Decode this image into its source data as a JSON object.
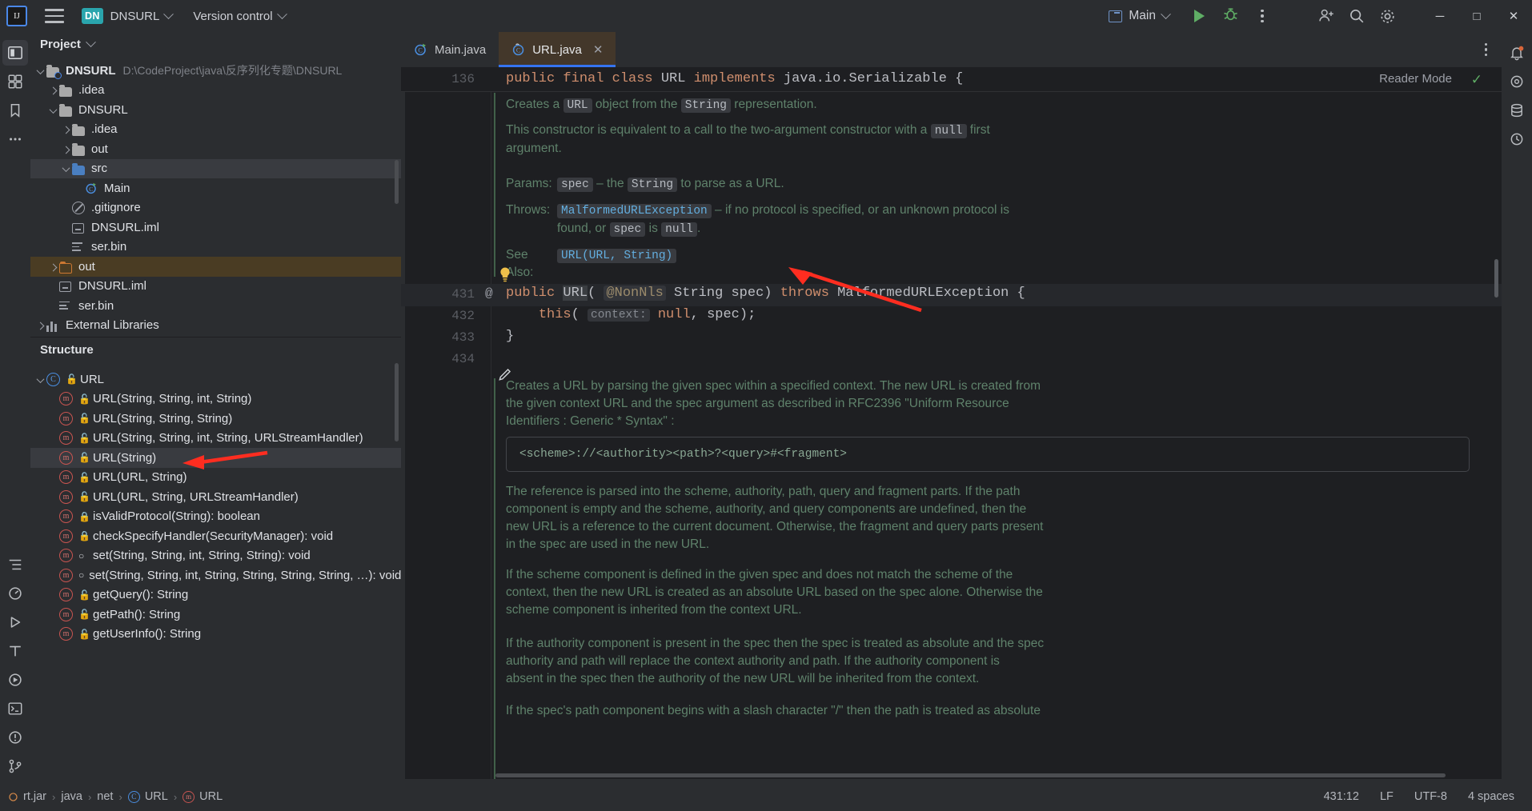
{
  "titlebar": {
    "logo": "IJ",
    "menu_icon": "hamburger-menu-icon",
    "project_badge": "DN",
    "project_name": "DNSURL",
    "version_control": "Version control",
    "run_config": "Main",
    "run_icon": "run-play-icon",
    "debug_icon": "debug-bug-icon",
    "more_icon": "more-vertical-icon",
    "add_user_icon": "add-user-icon",
    "search_icon": "search-icon",
    "settings_icon": "gear-icon",
    "minimize": "─",
    "maximize": "□",
    "close": "✕"
  },
  "left_rail": [
    {
      "name": "project-tool-icon",
      "glyph": "▣"
    },
    {
      "name": "commit-tool-icon",
      "glyph": "⊞"
    },
    {
      "name": "bookmarks-tool-icon",
      "glyph": "⚑"
    },
    {
      "name": "more-tool-icon",
      "glyph": "⋯"
    },
    {
      "name": "structure-tool-icon",
      "glyph": "≡"
    },
    {
      "name": "profiler-tool-icon",
      "glyph": "◔"
    },
    {
      "name": "run-tool-icon",
      "glyph": "▷"
    },
    {
      "name": "terminal-tool-icon",
      "glyph": "⌨"
    },
    {
      "name": "services-tool-icon",
      "glyph": "▶"
    },
    {
      "name": "problems-tool-icon",
      "glyph": "!"
    },
    {
      "name": "git-tool-icon",
      "glyph": "⑂"
    }
  ],
  "right_rail": [
    {
      "name": "notifications-icon",
      "glyph": "🔔"
    },
    {
      "name": "ai-assistant-icon",
      "glyph": "◎"
    },
    {
      "name": "database-icon",
      "glyph": "⛁"
    },
    {
      "name": "history-icon",
      "glyph": "⟲"
    }
  ],
  "project_panel": {
    "title": "Project",
    "chevron": "chevron-down-icon",
    "tree": [
      {
        "indent": 0,
        "toggle": "down",
        "icon": "folder-module",
        "label": "DNSURL",
        "bold": true,
        "path": "D:\\CodeProject\\java\\反序列化专题\\DNSURL"
      },
      {
        "indent": 1,
        "toggle": "right",
        "icon": "folder",
        "label": ".idea"
      },
      {
        "indent": 1,
        "toggle": "down",
        "icon": "folder",
        "label": "DNSURL"
      },
      {
        "indent": 2,
        "toggle": "right",
        "icon": "folder",
        "label": ".idea"
      },
      {
        "indent": 2,
        "toggle": "right",
        "icon": "folder",
        "label": "out"
      },
      {
        "indent": 2,
        "toggle": "down",
        "icon": "folder-source",
        "label": "src",
        "state": "selected"
      },
      {
        "indent": 3,
        "toggle": "none",
        "icon": "java-class-run",
        "label": "Main"
      },
      {
        "indent": 2,
        "toggle": "none",
        "icon": "gitignore",
        "label": ".gitignore"
      },
      {
        "indent": 2,
        "toggle": "none",
        "icon": "iml-file",
        "label": "DNSURL.iml"
      },
      {
        "indent": 2,
        "toggle": "none",
        "icon": "binary-file",
        "label": "ser.bin"
      },
      {
        "indent": 1,
        "toggle": "right",
        "icon": "folder-excluded",
        "label": "out",
        "state": "highlight"
      },
      {
        "indent": 1,
        "toggle": "none",
        "icon": "iml-file",
        "label": "DNSURL.iml"
      },
      {
        "indent": 1,
        "toggle": "none",
        "icon": "binary-file",
        "label": "ser.bin"
      },
      {
        "indent": 0,
        "toggle": "right",
        "icon": "libraries",
        "label": "External Libraries"
      }
    ]
  },
  "structure_panel": {
    "title": "Structure",
    "items": [
      {
        "indent": 0,
        "toggle": "down",
        "icon": "class-icon",
        "access": "public",
        "label": "URL"
      },
      {
        "indent": 1,
        "toggle": "none",
        "icon": "method-icon",
        "access": "public",
        "label": "URL(String, String, int, String)"
      },
      {
        "indent": 1,
        "toggle": "none",
        "icon": "method-icon",
        "access": "public",
        "label": "URL(String, String, String)"
      },
      {
        "indent": 1,
        "toggle": "none",
        "icon": "method-icon",
        "access": "public",
        "label": "URL(String, String, int, String, URLStreamHandler)"
      },
      {
        "indent": 1,
        "toggle": "none",
        "icon": "method-icon",
        "access": "public",
        "label": "URL(String)",
        "state": "selected"
      },
      {
        "indent": 1,
        "toggle": "none",
        "icon": "method-icon",
        "access": "public",
        "label": "URL(URL, String)"
      },
      {
        "indent": 1,
        "toggle": "none",
        "icon": "method-icon",
        "access": "public",
        "label": "URL(URL, String, URLStreamHandler)"
      },
      {
        "indent": 1,
        "toggle": "none",
        "icon": "method-icon",
        "access": "private",
        "label": "isValidProtocol(String): boolean"
      },
      {
        "indent": 1,
        "toggle": "none",
        "icon": "method-icon",
        "access": "private",
        "label": "checkSpecifyHandler(SecurityManager): void"
      },
      {
        "indent": 1,
        "toggle": "none",
        "icon": "method-icon",
        "access": "package",
        "label": "set(String, String, int, String, String): void"
      },
      {
        "indent": 1,
        "toggle": "none",
        "icon": "method-icon",
        "access": "package",
        "label": "set(String, String, int, String, String, String, String, …): void"
      },
      {
        "indent": 1,
        "toggle": "none",
        "icon": "method-icon",
        "access": "public",
        "label": "getQuery(): String"
      },
      {
        "indent": 1,
        "toggle": "none",
        "icon": "method-icon",
        "access": "public",
        "label": "getPath(): String"
      },
      {
        "indent": 1,
        "toggle": "none",
        "icon": "method-icon",
        "access": "public",
        "label": "getUserInfo(): String"
      }
    ]
  },
  "editor": {
    "tabs": [
      {
        "label": "Main.java",
        "icon": "java-class-run-icon",
        "active": false,
        "closable": false
      },
      {
        "label": "URL.java",
        "icon": "java-class-icon",
        "active": true,
        "closable": true,
        "close": "✕"
      }
    ],
    "tab_options_icon": "more-vertical-icon",
    "reader_mode": "Reader Mode",
    "inspection_check": "✓",
    "sticky_line_number": "136",
    "sticky_code_parts": [
      {
        "t": "public final class ",
        "c": "kw"
      },
      {
        "t": "URL",
        "c": "plain"
      },
      {
        "t": " implements ",
        "c": "kw"
      },
      {
        "t": "java.io.Serializable {",
        "c": "plain"
      }
    ],
    "doc_top": {
      "lines": [
        [
          {
            "t": "Creates a ",
            "c": "txt"
          },
          {
            "t": "URL",
            "c": "mono"
          },
          {
            "t": " object from the ",
            "c": "txt"
          },
          {
            "t": "String",
            "c": "mono"
          },
          {
            "t": " representation.",
            "c": "txt"
          }
        ],
        [
          {
            "t": "This constructor is equivalent to a call to the two-argument constructor with a ",
            "c": "txt"
          },
          {
            "t": "null",
            "c": "mono"
          },
          {
            "t": " first",
            "c": "txt"
          }
        ],
        [
          {
            "t": "argument.",
            "c": "txt"
          }
        ]
      ],
      "params_label": "Params:",
      "params": [
        {
          "t": "spec",
          "c": "mono"
        },
        {
          "t": " – the ",
          "c": "txt"
        },
        {
          "t": "String",
          "c": "mono"
        },
        {
          "t": " to parse as a URL.",
          "c": "txt"
        }
      ],
      "throws_label": "Throws:",
      "throws_line1": [
        {
          "t": "MalformedURLException",
          "c": "lnk"
        },
        {
          "t": " – if no protocol is specified, or an unknown protocol is",
          "c": "txt"
        }
      ],
      "throws_line2": [
        {
          "t": "found, or ",
          "c": "txt"
        },
        {
          "t": "spec",
          "c": "mono"
        },
        {
          "t": " is ",
          "c": "txt"
        },
        {
          "t": "null",
          "c": "mono"
        },
        {
          "t": ".",
          "c": "txt"
        }
      ],
      "seealso_label": "See Also:",
      "seealso_link": "URL(URL, String)"
    },
    "code_lines": [
      {
        "num": "431",
        "marker": "@",
        "parts": [
          {
            "t": "public ",
            "c": "kw"
          },
          {
            "t": "URL",
            "c": "cursor"
          },
          {
            "t": "( ",
            "c": "plain"
          },
          {
            "t": "@NonNls",
            "c": "anno"
          },
          {
            "t": " String spec) ",
            "c": "plain"
          },
          {
            "t": "throws ",
            "c": "kw"
          },
          {
            "t": "MalformedURLException {",
            "c": "plain"
          }
        ]
      },
      {
        "num": "432",
        "marker": "",
        "parts": [
          {
            "t": "    this",
            "c": "kw2"
          },
          {
            "t": "( ",
            "c": "plain"
          },
          {
            "t": "context:",
            "c": "hint"
          },
          {
            "t": " null",
            "c": "kw"
          },
          {
            "t": ", spec);",
            "c": "plain"
          }
        ]
      },
      {
        "num": "433",
        "marker": "",
        "parts": [
          {
            "t": "}",
            "c": "plain"
          }
        ]
      },
      {
        "num": "434",
        "marker": "",
        "parts": []
      }
    ],
    "bulb_icon": "lightbulb-icon",
    "pencil_icon": "pencil-edit-icon",
    "doc_bottom": {
      "paragraph1": [
        "Creates a URL by parsing the given spec within a specified context. The new URL is created from",
        "the given context URL and the spec argument as described in RFC2396 \"Uniform Resource",
        "Identifiers : Generic * Syntax\" :"
      ],
      "code_sample": "<scheme>://<authority><path>?<query>#<fragment>",
      "paragraph2": [
        "The reference is parsed into the scheme, authority, path, query and fragment parts. If the path",
        "component is empty and the scheme, authority, and query components are undefined, then the",
        "new URL is a reference to the current document. Otherwise, the fragment and query parts present",
        "in the spec are used in the new URL."
      ],
      "paragraph3": [
        "If the scheme component is defined in the given spec and does not match the scheme of the",
        "context, then the new URL is created as an absolute URL based on the spec alone. Otherwise the",
        "scheme component is inherited from the context URL."
      ],
      "paragraph4": [
        "If the authority component is present in the spec then the spec is treated as absolute and the spec",
        "authority and path will replace the context authority and path. If the authority component is",
        "absent in the spec then the authority of the new URL will be inherited from the context."
      ],
      "paragraph5": [
        "If the spec's path component begins with a slash character \"/\" then the path is treated as absolute"
      ]
    }
  },
  "status_bar": {
    "breadcrumbs": [
      {
        "label": "rt.jar",
        "icon": "jar-icon"
      },
      {
        "label": "java",
        "icon": ""
      },
      {
        "label": "net",
        "icon": ""
      },
      {
        "label": "URL",
        "icon": "class-icon"
      },
      {
        "label": "URL",
        "icon": "method-icon"
      }
    ],
    "separator": "›",
    "caret_position": "431:12",
    "line_separator": "LF",
    "encoding": "UTF-8",
    "indent": "4 spaces"
  },
  "colors": {
    "accent_blue": "#3574f0",
    "tab_active_bg": "#43372a",
    "panel_bg": "#2b2d30",
    "editor_bg": "#1e1f22",
    "doc_green": "#5f826b",
    "keyword_orange": "#cf8e6d",
    "annotation_red": "#ff3b30",
    "run_green": "#5fad65"
  }
}
